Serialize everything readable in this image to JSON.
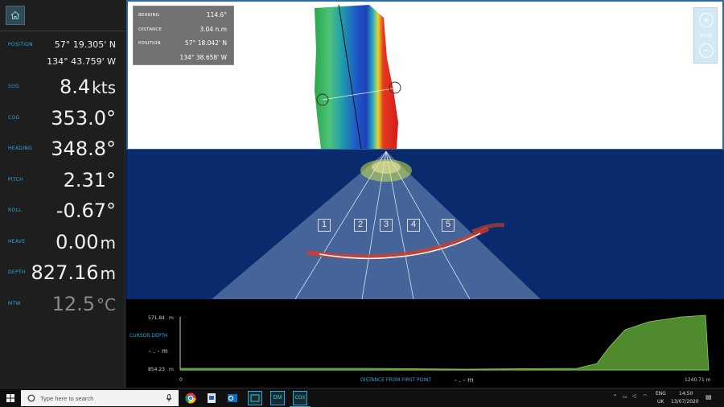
{
  "sidebar": {
    "position_label": "POSITION",
    "lat": "57° 19.305' N",
    "lon": "134° 43.759' W",
    "rows": [
      {
        "label": "SOG",
        "value": "8.4",
        "unit": "kts"
      },
      {
        "label": "COG",
        "value": "353.0°",
        "unit": ""
      },
      {
        "label": "HEADING",
        "value": "348.8°",
        "unit": ""
      },
      {
        "label": "PITCH",
        "value": "2.31°",
        "unit": ""
      },
      {
        "label": "ROLL",
        "value": "-0.67°",
        "unit": ""
      },
      {
        "label": "HEAVE",
        "value": "0.00",
        "unit": "m"
      },
      {
        "label": "DEPTH",
        "value": "827.16",
        "unit": "m"
      },
      {
        "label": "MTW",
        "value": "12.5",
        "unit": "°C"
      }
    ]
  },
  "map": {
    "info": {
      "bearing_label": "BEARING",
      "bearing": "114.6°",
      "distance_label": "DISTANCE",
      "distance": "3.04 n.m",
      "position_label": "POSITION",
      "lat": "57° 18.042' N",
      "lon": "134° 38.658' W"
    },
    "zoom_label": "ZOOM",
    "zoom_in": "+",
    "zoom_out": "−"
  },
  "sonar": {
    "beams": [
      "1",
      "2",
      "3",
      "4",
      "5"
    ]
  },
  "profile": {
    "top_depth": "571.84",
    "top_unit": "m",
    "cursor_label": "CURSOR DEPTH",
    "cursor_value": "- . - m",
    "bottom_depth": "854.23",
    "bottom_unit": "m",
    "x_start": "0",
    "x_label": "DISTANCE FROM FIRST POINT",
    "x_cursor": "- . - m",
    "x_end": "1240.71 m"
  },
  "taskbar": {
    "search_placeholder": "Type here to search",
    "lang": "ENG",
    "region": "UK",
    "time": "14:50",
    "date": "13/07/2020",
    "app_dm": "DM",
    "app_cox": "COX"
  },
  "colors": {
    "accent": "#29a9e0",
    "sonar_bg": "#0a2a6e",
    "profile_fill": "#4f8a2e"
  }
}
